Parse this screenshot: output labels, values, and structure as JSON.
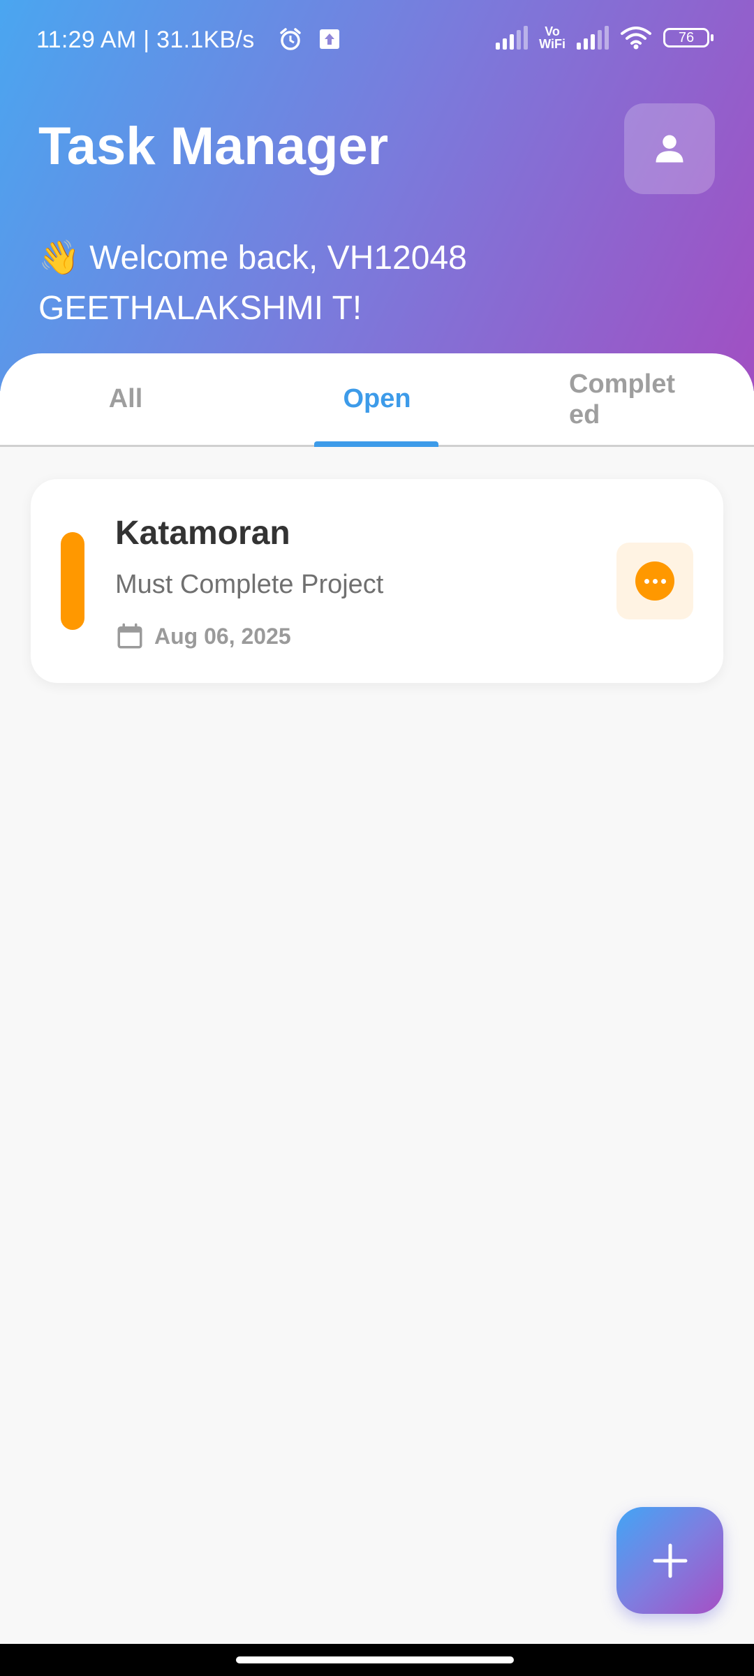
{
  "status_bar": {
    "time_and_speed": "11:29 AM | 31.1KB/s",
    "vowifi_line1": "Vo",
    "vowifi_line2": "WiFi",
    "battery_level": "76",
    "icons": [
      "alarm-icon",
      "upload-icon",
      "signal-icon",
      "vowifi-icon",
      "signal-icon",
      "wifi-icon",
      "battery-icon"
    ]
  },
  "header": {
    "title": "Task Manager",
    "welcome_emoji": "👋",
    "welcome_text": "Welcome back, VH12048 GEETHALAKSHMI T!",
    "profile_icon": "person-icon",
    "gradient_colors": [
      "#4aa6f0",
      "#7a7bdc",
      "#a14fc2"
    ]
  },
  "tabs": [
    {
      "label": "All",
      "active": false
    },
    {
      "label": "Open",
      "active": true
    },
    {
      "label": "Completed",
      "active": false
    }
  ],
  "accent_color": "#3d9be9",
  "tasks": [
    {
      "title": "Katamoran",
      "description": "Must Complete Project",
      "date": "Aug 06, 2025",
      "date_icon": "calendar-icon",
      "status_icon": "more-horizontal-icon",
      "priority_color": "#ff9800"
    }
  ],
  "fab": {
    "icon": "plus-icon"
  }
}
